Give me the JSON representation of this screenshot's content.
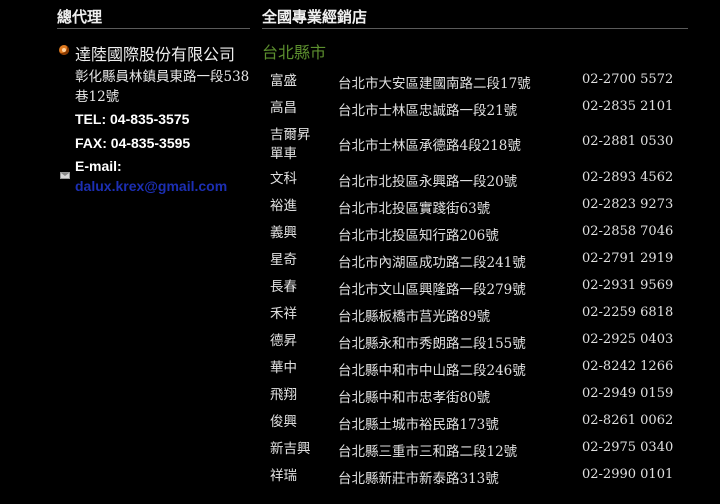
{
  "left": {
    "header": "總代理",
    "company": "達陸國際股份有限公司",
    "address": "彰化縣員林鎮員東路一段538巷12號",
    "tel": "TEL: 04-835-3575",
    "fax": "FAX: 04-835-3595",
    "email_label": "E-mail:",
    "email": "dalux.krex@gmail.com"
  },
  "right": {
    "header": "全國專業經銷店",
    "region": "台北縣市",
    "dealers": [
      {
        "name": "富盛",
        "address": "台北市大安區建國南路二段17號",
        "phone": "02-2700 5572"
      },
      {
        "name": "高昌",
        "address": "台北市士林區忠誠路一段21號",
        "phone": "02-2835 2101"
      },
      {
        "name": "吉爾昇單車",
        "address": "台北市士林區承德路4段218號",
        "phone": "02-2881 0530"
      },
      {
        "name": "文科",
        "address": "台北市北投區永興路一段20號",
        "phone": "02-2893 4562"
      },
      {
        "name": "裕進",
        "address": "台北市北投區實踐街63號",
        "phone": "02-2823 9273"
      },
      {
        "name": "義興",
        "address": "台北市北投區知行路206號",
        "phone": "02-2858 7046"
      },
      {
        "name": "星奇",
        "address": "台北市內湖區成功路二段241號",
        "phone": "02-2791 2919"
      },
      {
        "name": "長春",
        "address": "台北市文山區興隆路一段279號",
        "phone": "02-2931 9569"
      },
      {
        "name": "禾祥",
        "address": "台北縣板橋市莒光路89號",
        "phone": "02-2259 6818"
      },
      {
        "name": "德昇",
        "address": "台北縣永和市秀朗路二段155號",
        "phone": "02-2925 0403"
      },
      {
        "name": "華中",
        "address": "台北縣中和市中山路二段246號",
        "phone": "02-8242 1266"
      },
      {
        "name": "飛翔",
        "address": "台北縣中和市忠孝街80號",
        "phone": "02-2949 0159"
      },
      {
        "name": "俊興",
        "address": "台北縣土城市裕民路173號",
        "phone": "02-8261 0062"
      },
      {
        "name": "新吉興",
        "address": "台北縣三重市三和路二段12號",
        "phone": "02-2975 0340"
      },
      {
        "name": "祥瑞",
        "address": "台北縣新莊市新泰路313號",
        "phone": "02-2990 0101"
      }
    ]
  }
}
